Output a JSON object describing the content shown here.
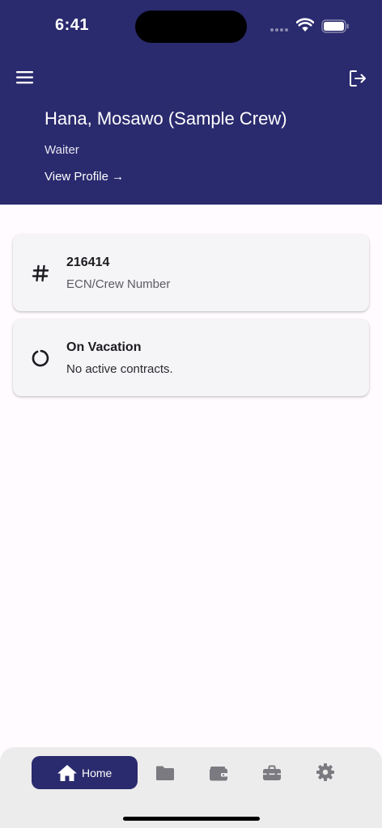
{
  "status_bar": {
    "time": "6:41",
    "icons": [
      "signal-icon",
      "wifi-icon",
      "battery-icon"
    ]
  },
  "header": {
    "menu_icon": "menu-icon",
    "logout_icon": "logout-icon",
    "crew_name": "Hana, Mosawo (Sample Crew)",
    "crew_role": "Waiter",
    "view_profile_label": "View Profile →"
  },
  "cards": [
    {
      "icon": "hash-icon",
      "title": "216414",
      "subtitle": "ECN/Crew Number"
    },
    {
      "icon": "loading-circle-icon",
      "title": "On Vacation",
      "subtitle": "No active contracts."
    }
  ],
  "bottom_nav": {
    "items": [
      {
        "icon": "home-icon",
        "label": "Home",
        "active": true
      },
      {
        "icon": "folder-icon",
        "label": "",
        "active": false
      },
      {
        "icon": "wallet-icon",
        "label": "",
        "active": false
      },
      {
        "icon": "toolbox-icon",
        "label": "",
        "active": false
      },
      {
        "icon": "gear-icon",
        "label": "",
        "active": false
      }
    ]
  },
  "colors": {
    "primary": "#2a2a6e",
    "background": "#fffbfe",
    "card": "#f5f5f8",
    "nav_inactive": "#7a7a80"
  }
}
